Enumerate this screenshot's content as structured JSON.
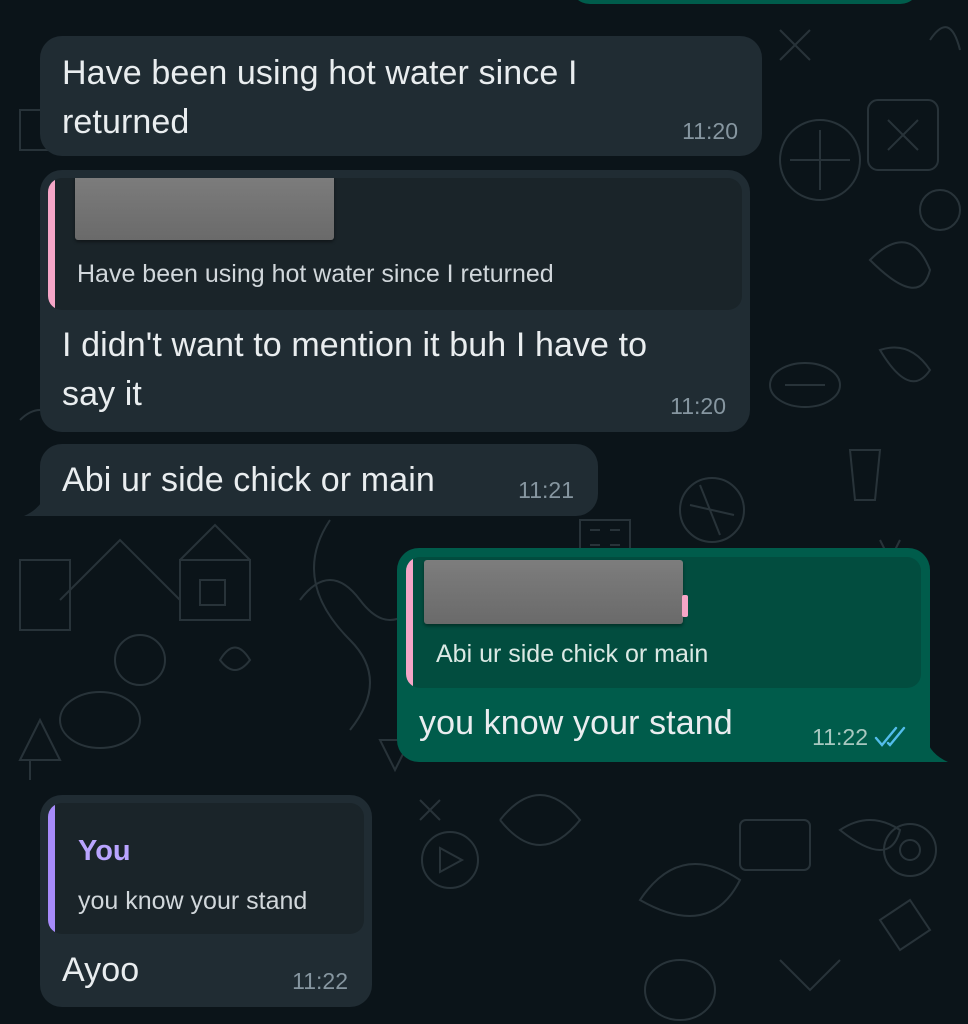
{
  "theme": {
    "background": "#0b1419",
    "incoming_bubble": "#202c33",
    "outgoing_bubble": "#005c4b",
    "text": "#e9edef",
    "timestamp": "#8696a0",
    "read_receipt": "#53bdeb",
    "quote_bar_pink": "#f5a6c7",
    "quote_bar_purple": "#a78bfa"
  },
  "messages": [
    {
      "direction": "incoming",
      "text_line1": "Have been using hot water since I",
      "text_line2": "returned",
      "time": "11:20"
    },
    {
      "direction": "incoming",
      "quote": {
        "sender_name": "[redacted]",
        "text": "Have been using hot water since I returned"
      },
      "text_line1": "I didn't want to mention it buh I have to",
      "text_line2": "say it",
      "time": "11:20"
    },
    {
      "direction": "incoming",
      "text": "Abi ur side chick or main",
      "time": "11:21"
    },
    {
      "direction": "outgoing",
      "quote": {
        "sender_name": "[redacted]",
        "text": "Abi ur side chick or main"
      },
      "text": "you know your stand",
      "time": "11:22",
      "status_icon": "double-check-read-icon"
    },
    {
      "direction": "incoming",
      "quote": {
        "sender_name": "You",
        "text": "you know your stand"
      },
      "text": "Ayoo",
      "time": "11:22"
    }
  ]
}
